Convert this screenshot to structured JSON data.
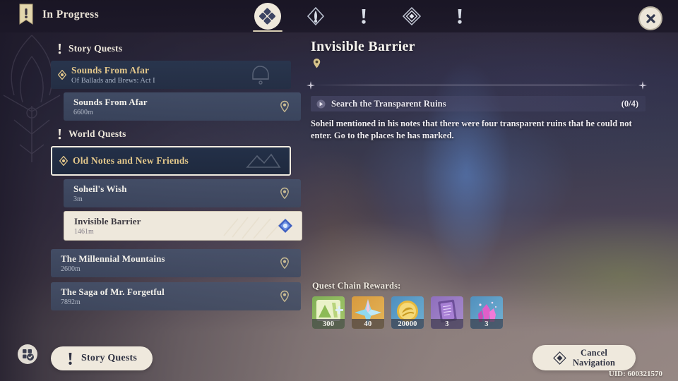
{
  "header": {
    "title": "In Progress",
    "banner_icon": "quest-banner-icon",
    "close_icon": "close-icon",
    "tabs": [
      {
        "id": "all",
        "icon": "four-diamonds-icon",
        "active": true
      },
      {
        "id": "story",
        "icon": "story-quest-icon",
        "active": false
      },
      {
        "id": "world",
        "icon": "exclamation-icon",
        "active": false
      },
      {
        "id": "archon",
        "icon": "archon-quest-icon",
        "active": false
      },
      {
        "id": "other",
        "icon": "exclamation-alt-icon",
        "active": false
      }
    ]
  },
  "sidebar": {
    "sections": [
      {
        "label": "Story Quests",
        "icon": "exclamation-icon",
        "chain": {
          "title": "Sounds From Afar",
          "subtitle": "Of Ballads and Brews: Act I",
          "icon": "quest-diamond-icon",
          "selected": false
        },
        "entries": [
          {
            "title": "Sounds From Afar",
            "distance": "6600m",
            "marker": "pin-icon",
            "selected": false
          }
        ]
      },
      {
        "label": "World Quests",
        "icon": "exclamation-icon",
        "chain": {
          "title": "Old Notes and New Friends",
          "subtitle": "",
          "icon": "quest-diamond-icon",
          "selected": true
        },
        "entries": [
          {
            "title": "Soheil's Wish",
            "distance": "3m",
            "marker": "pin-icon",
            "selected": false
          },
          {
            "title": "Invisible Barrier",
            "distance": "1461m",
            "marker": "navigation-diamond-icon",
            "selected": true
          }
        ]
      }
    ],
    "standalone_entries": [
      {
        "title": "The Millennial Mountains",
        "distance": "2600m",
        "marker": "pin-icon",
        "selected": false
      },
      {
        "title": "The Saga of Mr. Forgetful",
        "distance": "7892m",
        "marker": "pin-icon",
        "selected": false
      }
    ]
  },
  "detail": {
    "title": "Invisible Barrier",
    "pin_icon": "pin-icon",
    "objective": {
      "arrow_icon": "arrow-right-icon",
      "label": "Search the Transparent Ruins",
      "count": "(0/4)"
    },
    "description": "Soheil mentioned in his notes that there were four transparent ruins that he could not enter. Go to the places he has marked."
  },
  "rewards": {
    "label": "Quest Chain Rewards:",
    "items": [
      {
        "name": "adventure-exp",
        "qty": "300",
        "swatch": "r-green"
      },
      {
        "name": "primogem",
        "qty": "40",
        "swatch": "r-orange"
      },
      {
        "name": "mora",
        "qty": "20000",
        "swatch": "r-blue"
      },
      {
        "name": "heros-wit",
        "qty": "3",
        "swatch": "r-purple"
      },
      {
        "name": "mystic-ore",
        "qty": "3",
        "swatch": "r-blue2"
      }
    ]
  },
  "footer": {
    "tracker_icon": "quest-tracker-icon",
    "story_button": {
      "icon": "exclamation-icon",
      "label": "Story Quests"
    },
    "cancel_button": {
      "icon": "navigation-diamond-icon",
      "line1": "Cancel",
      "line2": "Navigation"
    },
    "uid": "UID: 600321570"
  },
  "colors": {
    "accent_gold": "#e4c88b",
    "cream": "#efe9dd",
    "panel_blue": "#293650",
    "entry_blue": "#46546e",
    "nav_diamond": "#4a6fd0"
  }
}
